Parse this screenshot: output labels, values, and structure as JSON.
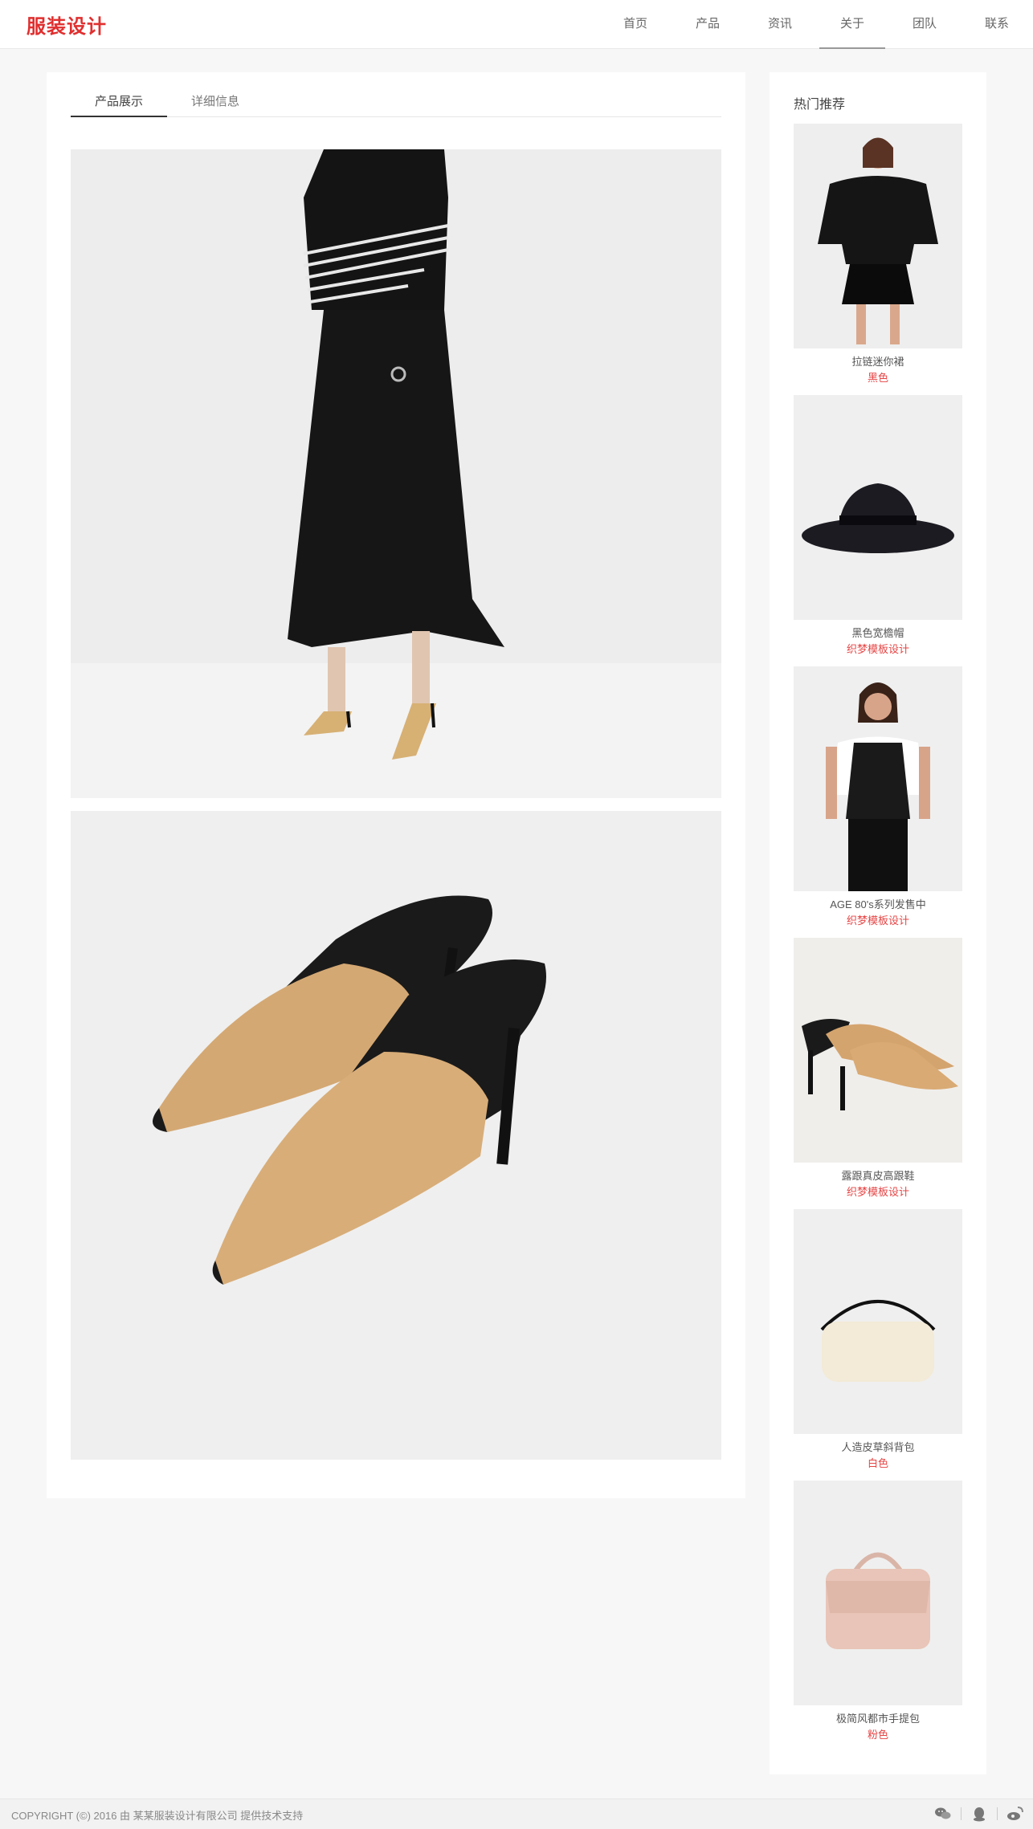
{
  "header": {
    "logo": "服装设计",
    "nav": [
      "首页",
      "产品",
      "资讯",
      "关于",
      "团队",
      "联系"
    ],
    "active_nav": "关于"
  },
  "main": {
    "tabs": [
      "产品展示",
      "详细信息"
    ],
    "active_tab": "产品展示",
    "photos": [
      "model-in-black-dress-photo",
      "suede-mule-heels-photo"
    ]
  },
  "sidebar": {
    "title": "热门推荐",
    "items": [
      {
        "name": "拉链迷你裙",
        "sub": "黑色",
        "image": "black-sweater-skirt-model"
      },
      {
        "name": "黑色宽檐帽",
        "sub": "织梦模板设计",
        "image": "black-wide-brim-hat"
      },
      {
        "name": "AGE 80's系列发售中",
        "sub": "织梦模板设计",
        "image": "leather-top-model"
      },
      {
        "name": "露跟真皮高跟鞋",
        "sub": "织梦模板设计",
        "image": "suede-mule-heels"
      },
      {
        "name": "人造皮草斜背包",
        "sub": "白色",
        "image": "white-faux-fur-bag"
      },
      {
        "name": "极简风都市手提包",
        "sub": "粉色",
        "image": "pink-handbag"
      }
    ]
  },
  "footer": {
    "copyright": "COPYRIGHT (©) 2016 由 某某服装设计有限公司 提供技术支持",
    "icons": [
      "wechat-icon",
      "qq-icon",
      "weibo-icon"
    ]
  },
  "colors": {
    "brand": "#e02f2f",
    "accent_red": "#e64545",
    "background": "#f7f7f7"
  }
}
